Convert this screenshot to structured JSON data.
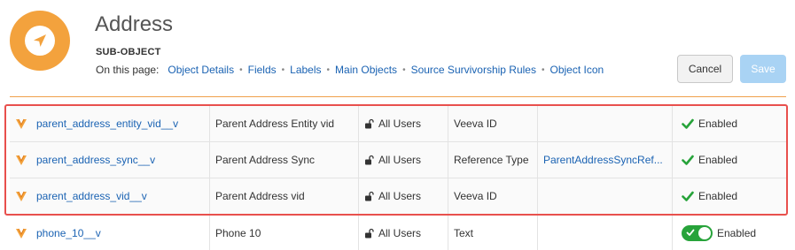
{
  "header": {
    "title": "Address",
    "subtitle": "SUB-OBJECT",
    "on_this_page_label": "On this page:",
    "links": [
      "Object Details",
      "Fields",
      "Labels",
      "Main Objects",
      "Source Survivorship Rules",
      "Object Icon"
    ],
    "cancel_label": "Cancel",
    "save_label": "Save",
    "icon": "navigation-arrow-icon",
    "icon_color": "#f3a23d"
  },
  "fields": [
    {
      "name": "parent_address_entity_vid__v",
      "label": "Parent Address Entity vid",
      "access": "All Users",
      "type": "Veeva ID",
      "reference": "",
      "status": "Enabled",
      "status_style": "check"
    },
    {
      "name": "parent_address_sync__v",
      "label": "Parent Address Sync",
      "access": "All Users",
      "type": "Reference Type",
      "reference": "ParentAddressSyncRef...",
      "status": "Enabled",
      "status_style": "check"
    },
    {
      "name": "parent_address_vid__v",
      "label": "Parent Address vid",
      "access": "All Users",
      "type": "Veeva ID",
      "reference": "",
      "status": "Enabled",
      "status_style": "check"
    },
    {
      "name": "phone_10__v",
      "label": "Phone 10",
      "access": "All Users",
      "type": "Text",
      "reference": "",
      "status": "Enabled",
      "status_style": "toggle"
    }
  ],
  "colors": {
    "accent": "#f0a04b",
    "link": "#1b63b3",
    "enabled": "#27a33a",
    "highlight": "#e8504d"
  }
}
